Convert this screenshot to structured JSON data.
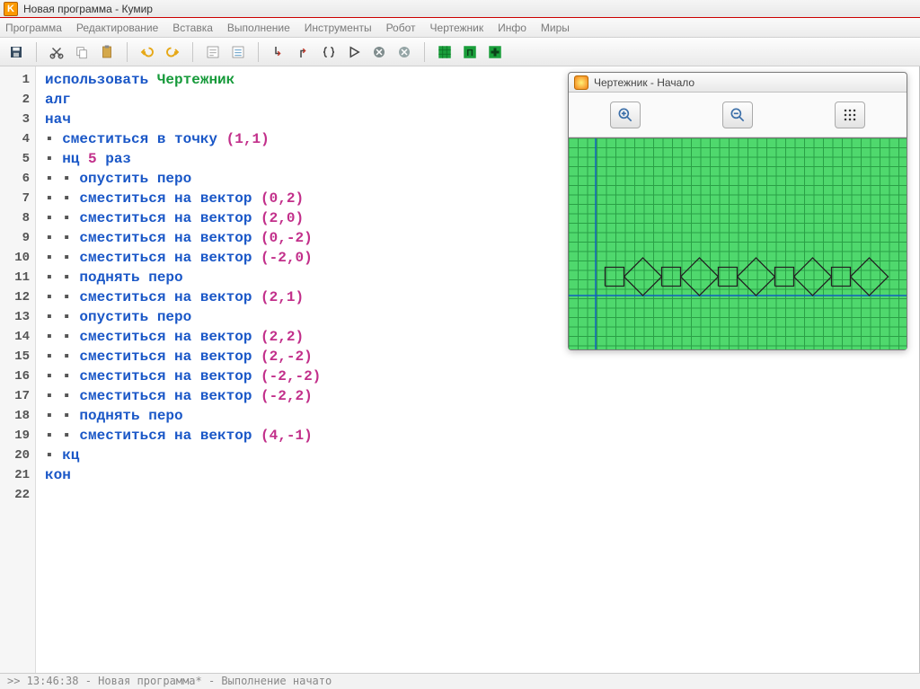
{
  "window": {
    "title": "Новая программа - Кумир",
    "app_icon_letter": "K"
  },
  "menu": {
    "items": [
      "Программа",
      "Редактирование",
      "Вставка",
      "Выполнение",
      "Инструменты",
      "Робот",
      "Чертежник",
      "Инфо",
      "Миры"
    ]
  },
  "code": {
    "lines": [
      {
        "n": 1,
        "tokens": [
          {
            "t": "использовать ",
            "c": "kw"
          },
          {
            "t": "Чертежник",
            "c": "actor"
          }
        ]
      },
      {
        "n": 2,
        "tokens": [
          {
            "t": "алг",
            "c": "kw"
          }
        ]
      },
      {
        "n": 3,
        "tokens": [
          {
            "t": "нач",
            "c": "kw"
          }
        ]
      },
      {
        "n": 4,
        "tokens": [
          {
            "t": "▪ ",
            "c": "dot"
          },
          {
            "t": "сместиться в точку ",
            "c": "kw"
          },
          {
            "t": "(",
            "c": "punct"
          },
          {
            "t": "1",
            "c": "num"
          },
          {
            "t": ",",
            "c": "punct"
          },
          {
            "t": "1",
            "c": "num"
          },
          {
            "t": ")",
            "c": "punct"
          }
        ]
      },
      {
        "n": 5,
        "tokens": [
          {
            "t": "▪ ",
            "c": "dot"
          },
          {
            "t": "нц ",
            "c": "kw"
          },
          {
            "t": "5",
            "c": "num"
          },
          {
            "t": " раз",
            "c": "kw"
          }
        ]
      },
      {
        "n": 6,
        "tokens": [
          {
            "t": "▪ ▪ ",
            "c": "dot"
          },
          {
            "t": "опустить перо",
            "c": "kw"
          }
        ]
      },
      {
        "n": 7,
        "tokens": [
          {
            "t": "▪ ▪ ",
            "c": "dot"
          },
          {
            "t": "сместиться на вектор ",
            "c": "kw"
          },
          {
            "t": "(",
            "c": "punct"
          },
          {
            "t": "0",
            "c": "num"
          },
          {
            "t": ",",
            "c": "punct"
          },
          {
            "t": "2",
            "c": "num"
          },
          {
            "t": ")",
            "c": "punct"
          }
        ]
      },
      {
        "n": 8,
        "tokens": [
          {
            "t": "▪ ▪ ",
            "c": "dot"
          },
          {
            "t": "сместиться на вектор ",
            "c": "kw"
          },
          {
            "t": "(",
            "c": "punct"
          },
          {
            "t": "2",
            "c": "num"
          },
          {
            "t": ",",
            "c": "punct"
          },
          {
            "t": "0",
            "c": "num"
          },
          {
            "t": ")",
            "c": "punct"
          }
        ]
      },
      {
        "n": 9,
        "tokens": [
          {
            "t": "▪ ▪ ",
            "c": "dot"
          },
          {
            "t": "сместиться на вектор ",
            "c": "kw"
          },
          {
            "t": "(",
            "c": "punct"
          },
          {
            "t": "0",
            "c": "num"
          },
          {
            "t": ",",
            "c": "punct"
          },
          {
            "t": "-2",
            "c": "num"
          },
          {
            "t": ")",
            "c": "punct"
          }
        ]
      },
      {
        "n": 10,
        "tokens": [
          {
            "t": "▪ ▪ ",
            "c": "dot"
          },
          {
            "t": "сместиться на вектор ",
            "c": "kw"
          },
          {
            "t": "(",
            "c": "punct"
          },
          {
            "t": "-2",
            "c": "num"
          },
          {
            "t": ",",
            "c": "punct"
          },
          {
            "t": "0",
            "c": "num"
          },
          {
            "t": ")",
            "c": "punct"
          }
        ]
      },
      {
        "n": 11,
        "tokens": [
          {
            "t": "▪ ▪ ",
            "c": "dot"
          },
          {
            "t": "поднять перо",
            "c": "kw"
          }
        ]
      },
      {
        "n": 12,
        "tokens": [
          {
            "t": "▪ ▪ ",
            "c": "dot"
          },
          {
            "t": "сместиться на вектор ",
            "c": "kw"
          },
          {
            "t": "(",
            "c": "punct"
          },
          {
            "t": "2",
            "c": "num"
          },
          {
            "t": ",",
            "c": "punct"
          },
          {
            "t": "1",
            "c": "num"
          },
          {
            "t": ")",
            "c": "punct"
          }
        ]
      },
      {
        "n": 13,
        "tokens": [
          {
            "t": "▪ ▪ ",
            "c": "dot"
          },
          {
            "t": "опустить перо",
            "c": "kw"
          }
        ]
      },
      {
        "n": 14,
        "tokens": [
          {
            "t": "▪ ▪ ",
            "c": "dot"
          },
          {
            "t": "сместиться на вектор ",
            "c": "kw"
          },
          {
            "t": "(",
            "c": "punct"
          },
          {
            "t": "2",
            "c": "num"
          },
          {
            "t": ",",
            "c": "punct"
          },
          {
            "t": "2",
            "c": "num"
          },
          {
            "t": ")",
            "c": "punct"
          }
        ]
      },
      {
        "n": 15,
        "tokens": [
          {
            "t": "▪ ▪ ",
            "c": "dot"
          },
          {
            "t": "сместиться на вектор ",
            "c": "kw"
          },
          {
            "t": "(",
            "c": "punct"
          },
          {
            "t": "2",
            "c": "num"
          },
          {
            "t": ",",
            "c": "punct"
          },
          {
            "t": "-2",
            "c": "num"
          },
          {
            "t": ")",
            "c": "punct"
          }
        ]
      },
      {
        "n": 16,
        "tokens": [
          {
            "t": "▪ ▪ ",
            "c": "dot"
          },
          {
            "t": "сместиться на вектор ",
            "c": "kw"
          },
          {
            "t": "(",
            "c": "punct"
          },
          {
            "t": "-2",
            "c": "num"
          },
          {
            "t": ",",
            "c": "punct"
          },
          {
            "t": "-2",
            "c": "num"
          },
          {
            "t": ")",
            "c": "punct"
          }
        ]
      },
      {
        "n": 17,
        "tokens": [
          {
            "t": "▪ ▪ ",
            "c": "dot"
          },
          {
            "t": "сместиться на вектор ",
            "c": "kw"
          },
          {
            "t": "(",
            "c": "punct"
          },
          {
            "t": "-2",
            "c": "num"
          },
          {
            "t": ",",
            "c": "punct"
          },
          {
            "t": "2",
            "c": "num"
          },
          {
            "t": ")",
            "c": "punct"
          }
        ]
      },
      {
        "n": 18,
        "tokens": [
          {
            "t": "▪ ▪ ",
            "c": "dot"
          },
          {
            "t": "поднять перо",
            "c": "kw"
          }
        ]
      },
      {
        "n": 19,
        "tokens": [
          {
            "t": "▪ ▪ ",
            "c": "dot"
          },
          {
            "t": "сместиться на вектор ",
            "c": "kw"
          },
          {
            "t": "(",
            "c": "punct"
          },
          {
            "t": "4",
            "c": "num"
          },
          {
            "t": ",",
            "c": "punct"
          },
          {
            "t": "-1",
            "c": "num"
          },
          {
            "t": ")",
            "c": "punct"
          }
        ]
      },
      {
        "n": 20,
        "tokens": [
          {
            "t": "▪ ",
            "c": "dot"
          },
          {
            "t": "кц",
            "c": "kw"
          }
        ]
      },
      {
        "n": 21,
        "tokens": [
          {
            "t": "кон",
            "c": "kw"
          }
        ]
      },
      {
        "n": 22,
        "tokens": []
      }
    ]
  },
  "drawer": {
    "title": "Чертежник - Начало",
    "tools": {
      "zoom_in": "zoom-in",
      "zoom_out": "zoom-out",
      "grid": "grid"
    }
  },
  "status": ">> 13:46:38 - Новая программа* - Выполнение начато"
}
